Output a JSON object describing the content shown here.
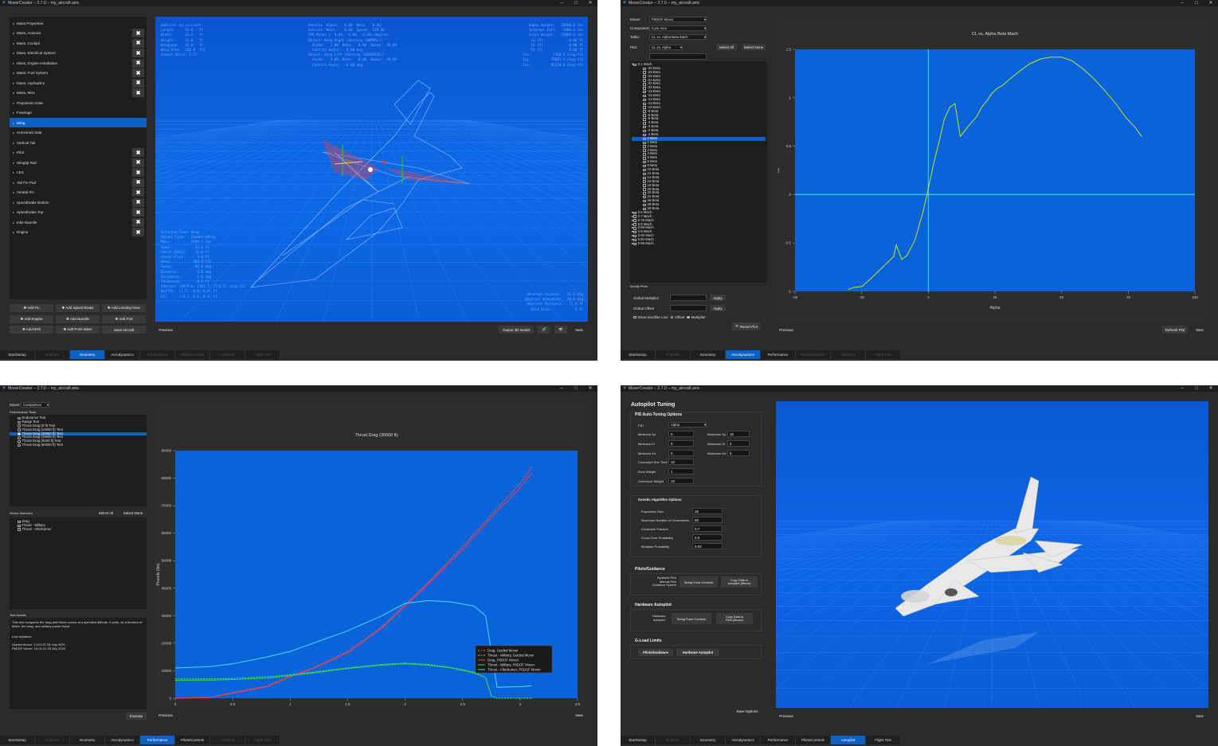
{
  "common": {
    "title": "MoverCreator -- 2.7.0 -- my_aircraft.amc",
    "minimize": "–",
    "maximize": "□",
    "close": "✕",
    "close_x": "✖",
    "previous": "Previous",
    "next": "Next",
    "tabs": [
      "Start/Setup",
      "Engines",
      "Geometry",
      "Aerodynamics",
      "Performance",
      "Pilots/Controls",
      "Autopilot",
      "Flight Test"
    ]
  },
  "geometry_window": {
    "items": [
      "Mass Properties",
      "Mass, Avionics",
      "Mass, Cockpit",
      "Mass, Electrical System",
      "Mass, Engine Installation",
      "Mass, Fuel System",
      "Mass, Hydraulics",
      "Mass, Misc",
      "Propulsion Data",
      "Fuselage",
      "Wing",
      "Horizontal Stab",
      "Vertical Tail",
      "Pitot",
      "Wingtip Rail",
      "LEX",
      "Tail Fin Pod",
      "Ventral Fin",
      "Speedbrake Bottom",
      "Speedbrake Top",
      "Inlet Nacelle",
      "Engine"
    ],
    "selected_item": "Wing",
    "buttons": [
      "✚ Add Fin",
      "✚ Add Speed Brake",
      "✚ Add Landing Gear",
      "✚ Add Engine",
      "✚ Add Nacelle",
      "✚ Add Pod",
      "✚ Add Dish",
      "✚ Add Point Mass",
      "Save Aircraft"
    ],
    "output_3d": "Output 3D Model",
    "overlay_top_left": "Vehicle: my_aircraft\nLength:     53.6   ft\nWidth:      32.5   ft\nHeight:     15.0   ft\nWingspan:   32.0   ft\nWing Area:  338.0  ft2\nAspect Ratio: 3.37",
    "overlay_top_center": "Vehicle  Alpha:   0.00  Beta:   0.00\nVehicle  Mach:    0.80  Speed:  529.00\nYPR Rates (  0.00,  0.00,  0.00) deg/sec\nObject: Wing_Right [Aeroing (NORMAL)]\n  Alpha:   1.00  Beta:   0.00  Sweep:  39.99\n  Control Angle:   0.00 deg\nObject: Wing_Left [Aeroing (INVERTED)]\n  Alpha:   1.00  Beta:   0.00  Sweep:  39.99\n  Control Angle:   0.00 deg",
    "overlay_top_right": "Empty Weight:   18000.0 lbs\nInternal Fuel:   7000.0 lbs\nGross Weight:   25000.0 lbs\nCG (X):           -0.00 ft\nCG (Y):            0.00 ft\nCG (Z):            0.00 ft\nIxx:           7166.9 slug-ft2\nIyy:          76667.4 slug-ft2\nIzz:          82234.0 slug-ft2",
    "overlay_bottom_left": "Selected Item: Wing\nObject Type:   GeometryWing\nMass:          2209.7 lbs\nSpan:            33.0 ft\nChord (Root):    16.0 ft\nChord (Tip):      3.0 ft\nArea:           304.0 ft2\nSweep:           40.0 deg\nDihedral:         0.0 deg\nIncidence:        1.0 deg\nThickness:        0.6 ft\nInertia: (3979.6, 1781.7, 5741.5) slug-ft2\nRef Pt:  (1.7, -0.0, 0.4) ft\nCG:      (-4.2, 0.0, 0.4) ft",
    "overlay_bottom_right": "Observer Azimuth:  -33.6 deg\nObserver Elevation:  28.0 deg\nObserver Distance:   71.8 ft\nGrid Size:            5 ft",
    "active_tab": "Geometry"
  },
  "aero_window": {
    "mover_label": "Mover:",
    "mover_value": "P6DOF Mover",
    "component_label": "Component:",
    "component_value": "Core Aero",
    "table_label": "Table:",
    "table_value": "CL vs. Alpha Beta Mach",
    "plot_label": "Plot:",
    "plot_value": "CL vs. Alpha",
    "select_all": "Select All",
    "select_none": "Select None",
    "tree_parent": "0.1 Mach",
    "tree_items": [
      "-30 Beta",
      "-28 Beta",
      "-26 Beta",
      "-24 Beta",
      "-22 Beta",
      "-20 Beta",
      "-18 Beta",
      "-16 Beta",
      "-14 Beta",
      "-12 Beta",
      "-10 Beta",
      "-8 Beta",
      "-6 Beta",
      "-5 Beta",
      "-4 Beta",
      "-3 Beta",
      "-2 Beta",
      "-1 Beta",
      "0 Beta",
      "1 Beta",
      "2 Beta",
      "3 Beta",
      "4 Beta",
      "5 Beta",
      "6 Beta",
      "8 Beta",
      "10 Beta",
      "12 Beta",
      "14 Beta",
      "16 Beta",
      "18 Beta",
      "20 Beta",
      "22 Beta",
      "24 Beta",
      "26 Beta",
      "28 Beta",
      "30 Beta"
    ],
    "tree_selected": "0 Beta",
    "tree_mach": [
      "0.5 Mach",
      "0.7 Mach",
      "0.75 Mach",
      "0.8 Mach",
      "0.85 Mach",
      "0.9 Mach",
      "0.92 Mach",
      "0.94 Mach",
      "0.96 Mach"
    ],
    "modify_plots": "Modify Plots",
    "global_multiplier": "Global Multiplier",
    "global_offset": "Global Offset",
    "apply": "Apply",
    "show_modifier": "Show Modifier Line",
    "offset": "Offset",
    "multiplier": "Multiplier",
    "revert_plot": "Revert Plot",
    "refresh_plot": "Refresh Plot",
    "active_tab": "Aerodynamics"
  },
  "perf_window": {
    "mover_label": "Mover:",
    "mover_value": "Comparison",
    "tests_label": "Performance Tests",
    "tests": [
      "Endurance Test",
      "Range Test",
      "Thrust Drag (0 ft) Test",
      "Thrust Drag (10000 ft) Test",
      "Thrust Drag (30000 ft) Test",
      "Thrust Drag (45000 ft) Test",
      "Thrust Drag (5000 ft) Test",
      "Thrust Drag (60000 ft) Test"
    ],
    "selected_test": "Thrust Drag (30000 ft) Test",
    "series_label": "Series Selection",
    "select_all": "Select All",
    "select_none": "Select None",
    "series": [
      "Drag",
      "Thrust - Military",
      "Thrust - Afterburner"
    ],
    "details_label": "Test Details",
    "details_text": "This test compares the drag and thrust curves at a specified altitude. It plots, as a function of Mach, the drag, and military power thrust.",
    "last_updated": "Last Updated:",
    "updated_1": "Guided Mover: 14:21:37 28 July 2020",
    "updated_2": "P6DOF Mover: 14:21:41 28 July 2020",
    "execute": "Execute",
    "active_tab": "Performance"
  },
  "ap_window": {
    "title": "Autopilot Tuning",
    "pid_section": "PID Auto-Tuning Options",
    "pid_label": "PID",
    "pid_value": "Alpha",
    "min_kp": "Minimum Kp",
    "min_kp_v": "0",
    "min_ki": "Minimum Ki",
    "min_ki_v": "0",
    "min_kd": "Minimum Kd",
    "min_kd_v": "0",
    "max_kp": "Maximum Kp",
    "max_kp_v": "15",
    "max_ki": "Maximum Ki",
    "max_ki_v": "5",
    "max_kd": "Maximum Kd",
    "max_kd_v": "5",
    "cmd_run": "Command Run Time",
    "cmd_run_v": "10",
    "err_w": "Error Weight",
    "err_w_v": "1",
    "over_w": "Overshoot Weight",
    "over_w_v": "10",
    "ga_section": "Genetic Algorithm Options",
    "pop": "Population Size",
    "pop_v": "25",
    "gens": "Maximum Number of Generations",
    "gens_v": "50",
    "cross": "Crossover Fraction",
    "cross_v": "0.7",
    "cross_p": "Cross-Over Probability",
    "cross_p_v": "0.5",
    "mut": "Mutation Probability",
    "mut_v": "0.02",
    "pilots_section": "Pilots/Guidance",
    "synth": "Synthetic Pilot\nManual Pilot\nGuidance System",
    "setup": "Setup/Tune Controls",
    "copy_ap": "Copy Data to\nAutopilot (Below)",
    "hw_section": "Hardware Autopilot",
    "hw_label": "Hardware\nAutopilot",
    "copy_pilot": "Copy Data to\nPilot (Above)",
    "g_section": "G-Load Limits",
    "g_pilots": "Pilots/Guidance",
    "g_hw": "Hardware Autopilot",
    "save_options": "Save Options",
    "active_tab": "Autopilot"
  },
  "chart_data": [
    {
      "type": "line",
      "title": "CL vs. Alpha Beta Mach",
      "xlabel": "Alpha",
      "ylabel": "CL",
      "xlim": [
        -50,
        100
      ],
      "ylim": [
        -1,
        1.5
      ],
      "xticks": [
        "-50",
        "-25",
        "0",
        "25",
        "50",
        "75",
        "100"
      ],
      "yticks": [
        "1.5",
        "1",
        "0.5",
        "0",
        "-0.5",
        "-1"
      ],
      "series": [
        {
          "x": [
            -30,
            -28,
            -25,
            -22,
            -19,
            -16,
            -13,
            -12,
            -10,
            -8,
            -5,
            -2,
            0,
            2,
            4,
            6,
            8,
            10,
            12,
            14,
            16,
            18,
            20,
            22,
            24,
            26,
            28,
            30,
            34,
            38,
            42,
            46,
            50,
            54,
            58,
            62,
            66,
            70,
            74,
            78,
            80
          ],
          "y": [
            -0.98,
            -0.96,
            -0.95,
            -0.88,
            -0.8,
            -0.72,
            -0.64,
            -0.52,
            -0.67,
            -0.63,
            -0.47,
            -0.18,
            0.06,
            0.32,
            0.54,
            0.78,
            0.9,
            0.94,
            0.6,
            0.67,
            0.74,
            0.8,
            0.9,
            0.97,
            1.05,
            1.1,
            1.13,
            1.18,
            1.27,
            1.35,
            1.4,
            1.42,
            1.42,
            1.38,
            1.3,
            1.2,
            1.08,
            0.95,
            0.8,
            0.68,
            0.6
          ]
        }
      ]
    },
    {
      "type": "line",
      "title": "Thrust Drag (30000 ft)",
      "xlabel": "Mach",
      "ylabel": "Pounds (lbs)",
      "xlim": [
        0,
        3.5
      ],
      "ylim": [
        0,
        90000
      ],
      "xticks": [
        "0",
        "0.5",
        "1",
        "1.5",
        "2",
        "2.5",
        "3",
        "3.5"
      ],
      "yticks": [
        "90000",
        "80000",
        "70000",
        "60000",
        "50000",
        "40000",
        "30000",
        "20000",
        "10000",
        "0"
      ],
      "legend_position": "bottom-right",
      "series": [
        {
          "name": "Drag, Guided Mover",
          "color": "#ff5a5a",
          "dashed": true,
          "x": [
            0,
            0.3,
            0.5,
            0.8,
            1,
            1.2,
            1.5,
            1.8,
            2,
            2.2,
            2.5,
            2.8,
            3,
            3.1
          ],
          "y": [
            0,
            300,
            2000,
            4500,
            8000,
            11000,
            17000,
            26000,
            34000,
            42000,
            55000,
            69000,
            78000,
            84000
          ]
        },
        {
          "name": "Thrust - Military, Guided Mover",
          "color": "#44ff44",
          "dashed": true,
          "x": [
            0,
            0.3,
            0.5,
            0.8,
            1,
            1.2,
            1.5,
            1.8,
            2,
            2.2,
            2.4,
            2.6,
            2.7,
            2.75,
            2.8,
            3.1
          ],
          "y": [
            7000,
            7000,
            7200,
            7800,
            8500,
            9500,
            11000,
            12300,
            12800,
            12300,
            11200,
            9500,
            7500,
            800,
            0,
            0
          ]
        },
        {
          "name": "Drag, P6DOF Mover",
          "color": "#ff3a3a",
          "dashed": false,
          "x": [
            0,
            0.3,
            0.5,
            0.8,
            1,
            1.2,
            1.5,
            1.8,
            2,
            2.2,
            2.5,
            2.8,
            3,
            3.1
          ],
          "y": [
            0,
            200,
            1800,
            4200,
            7800,
            10800,
            16500,
            25500,
            33500,
            41500,
            54000,
            68000,
            76500,
            82000
          ]
        },
        {
          "name": "Thrust - Military, P6DOF Mover",
          "color": "#39d639",
          "dashed": false,
          "x": [
            0,
            0.3,
            0.5,
            0.8,
            1,
            1.2,
            1.5,
            1.8,
            2,
            2.2,
            2.4,
            2.6,
            2.7,
            2.75
          ],
          "y": [
            6500,
            6600,
            6800,
            7300,
            8200,
            9200,
            10800,
            12000,
            12500,
            12000,
            11000,
            9200,
            7500,
            1000
          ]
        },
        {
          "name": "Thrust - Afterburner, P6DOF Mover",
          "color": "#43e0ff",
          "dashed": false,
          "x": [
            0,
            0.3,
            0.5,
            0.8,
            1,
            1.2,
            1.5,
            1.8,
            2,
            2.2,
            2.4,
            2.6,
            2.7,
            2.8,
            3,
            3.1
          ],
          "y": [
            11000,
            11500,
            12500,
            15000,
            17000,
            20000,
            24500,
            30000,
            34500,
            35500,
            35000,
            33500,
            30000,
            4000,
            4200,
            4500
          ]
        }
      ]
    }
  ]
}
